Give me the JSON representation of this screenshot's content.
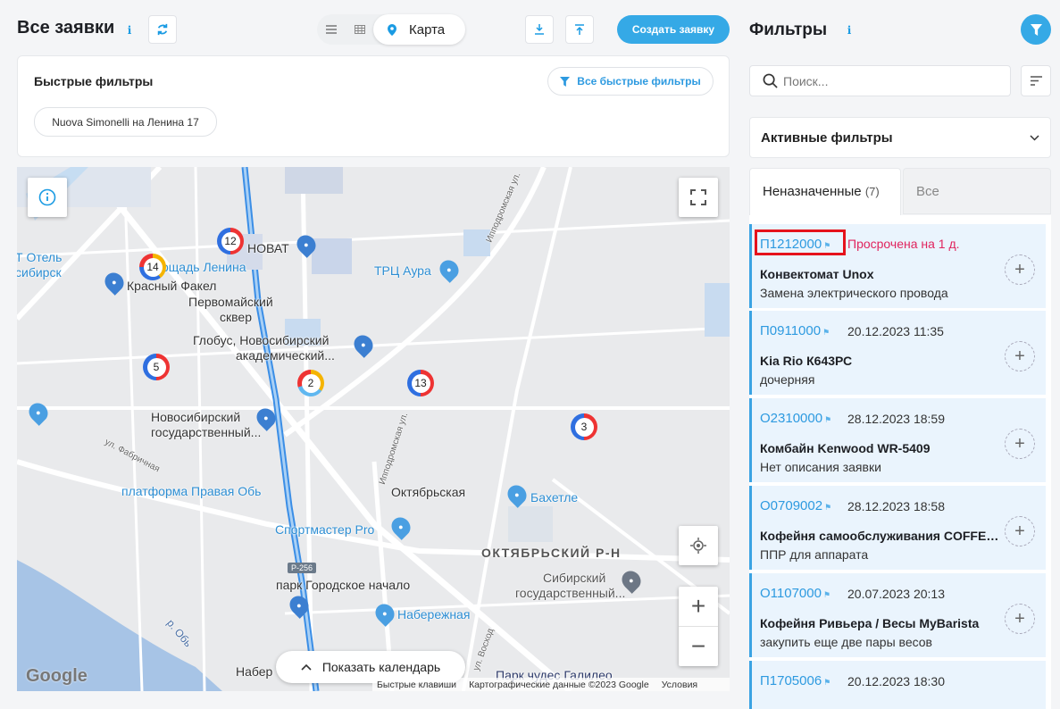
{
  "header": {
    "title": "Все заявки",
    "view_map_label": "Карта",
    "create_button": "Создать заявку"
  },
  "quick_filters": {
    "title": "Быстрые фильтры",
    "all_button": "Все быстрые фильтры",
    "chips": [
      "Nuova Simonelli на Ленина 17"
    ]
  },
  "map": {
    "show_calendar": "Показать календарь",
    "attribution": {
      "shortcuts": "Быстрые клавиши",
      "data": "Картографические данные ©2023 Google",
      "terms": "Условия",
      "logo": "Google"
    },
    "labels": {
      "novat": "НОВАТ",
      "hotel": "Т Отель",
      "sibirsk": "сибирск",
      "lenin_sq": "ощадь Ленина",
      "krasny_fakel": "Красный Факел",
      "pervomaisky1": "Первомайский",
      "pervomaisky2": "сквер",
      "aura": "ТРЦ Аура",
      "globus1": "Глобус, Новосибирский",
      "globus2": "академический...",
      "univ1": "Новосибирский",
      "univ2": "государственный...",
      "pravaya_ob": "платформа Правая Обь",
      "oktyabrskaya": "Октябрьская",
      "bakhetle": "Бахетле",
      "sportmaster": "Спортмастер Pro",
      "okt_district": "ОКТЯБРЬСКИЙ Р-Н",
      "sib_univ1": "Сибирский",
      "sib_univ2": "государственный...",
      "park": "парк Городское начало",
      "naberezhnaya": "Набережная",
      "nabere": "Набер",
      "galileo": "Парк чудес Галилео",
      "river": "р. Обь",
      "st_fabrichnaya": "ул. Фабричная",
      "st_ippodrom1": "Ипподромская ул.",
      "st_ippodrom2": "Ипподромская ул.",
      "st_voskhod": "ул. Восход",
      "r256": "Р-256"
    },
    "markers": [
      "12",
      "14",
      "5",
      "2",
      "13",
      "3"
    ]
  },
  "filters": {
    "title": "Фильтры",
    "search_placeholder": "Поиск...",
    "active_filters": "Активные фильтры",
    "tabs": [
      {
        "label": "Неназначенные",
        "count": "(7)"
      },
      {
        "label": "Все"
      }
    ]
  },
  "tickets": [
    {
      "number": "П1212000",
      "status": "Просрочена на 1 д.",
      "title": "Конвектомат Unox",
      "desc": "Замена электрического провода"
    },
    {
      "number": "П0911000",
      "date": "20.12.2023 11:35",
      "title": "Kia Rio К643РС",
      "desc": "дочерняя"
    },
    {
      "number": "О2310000",
      "date": "28.12.2023 18:59",
      "title": "Комбайн Kenwood WR-5409",
      "desc": "Нет описания заявки"
    },
    {
      "number": "О0709002",
      "date": "28.12.2023 18:58",
      "title": "Кофейня самообслуживания COFFEE ...",
      "desc": "ППР для аппарата"
    },
    {
      "number": "О1107000",
      "date": "20.07.2023 20:13",
      "title": "Кофейня Ривьера / Весы MyBarista",
      "desc": "закупить еще две пары весов"
    },
    {
      "number": "П1705006",
      "date": "20.12.2023 18:30",
      "title": "",
      "desc": ""
    }
  ],
  "colors": {
    "accent": "#35a9e6",
    "overdue": "#e0245e",
    "highlight": "#e5121b"
  }
}
